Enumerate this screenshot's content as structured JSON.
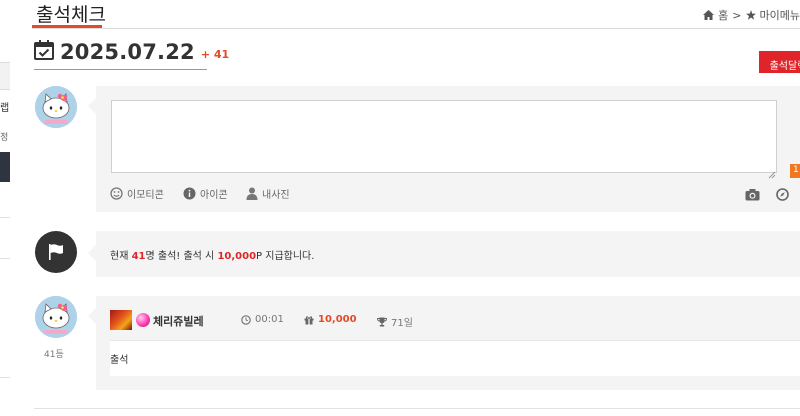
{
  "header": {
    "title": "출석체크",
    "breadcrumb": [
      "홈",
      "마이메뉴"
    ],
    "home_icon": "home-icon",
    "star_icon": "star-icon"
  },
  "sidebar_fragments": {
    "item1": "랩",
    "item2": "정"
  },
  "date": {
    "value": "2025.07.22",
    "delta": "+ 41",
    "icon": "calendar-check-icon"
  },
  "actions": {
    "attendance_button": "출석달력"
  },
  "comment_form": {
    "textarea_placeholder": "",
    "tools": {
      "emoticon": "이모티콘",
      "icon": "아이콘",
      "my_photo": "내사진"
    },
    "badge": "1"
  },
  "notice": {
    "prefix": "현재",
    "count": "41",
    "middle": "명 출석! 출석 시",
    "reward": "10,000",
    "suffix": "P 지급합니다."
  },
  "entries": [
    {
      "nickname": "체리쥬빌레",
      "time": "00:01",
      "points": "10,000",
      "streak": "71일",
      "message": "출석",
      "rank": "41등"
    }
  ],
  "colors": {
    "accent": "#e34a26",
    "button_red": "#e0252a",
    "panel_bg": "#f4f4f4"
  }
}
